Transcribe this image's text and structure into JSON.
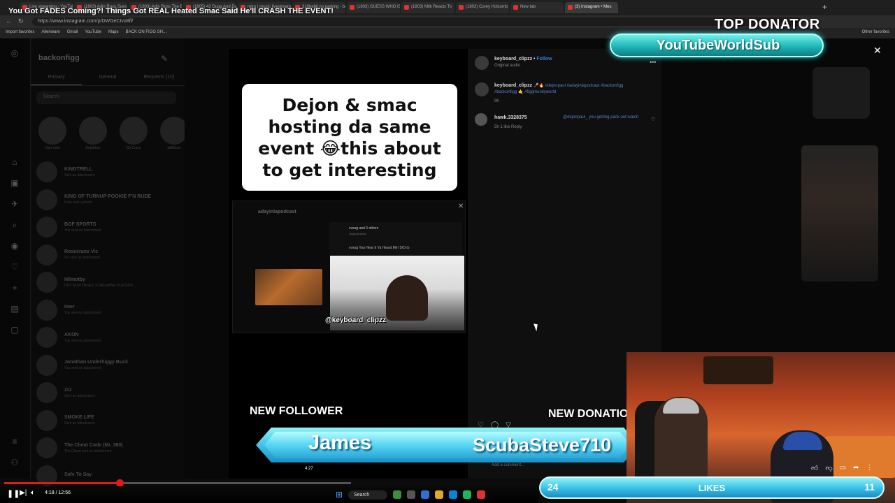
{
  "browser": {
    "video_title": "You Got FADES Coming?! Things Got REAL Heated Smac Said He'll CRASH THE EVENT!",
    "tabs": [
      "Live streaming - YouTub",
      "(1803) Adin Ross Sues E",
      "(1803) Adin Ross The Bu",
      "(1805) 42 Dugg And Da",
      "retro | music livestream",
      "310bebli no parking - ba",
      "(1803) GUESS WHO IS T",
      "(1803) Milk Reacts To",
      "(1802) Corey Holcomb D",
      "New tab",
      "(3) Instagram • Mes"
    ],
    "url": "https://www.instagram.com/p/DWGeCIvo8fl/",
    "bookmarks": [
      "Import favorites",
      "Alienware",
      "Gmail",
      "YouTube",
      "Maps",
      "BACK ON FIGG SH..."
    ],
    "other_favorites": "Other favorites"
  },
  "inbox": {
    "username": "backonfigg",
    "tabs": [
      "Primary",
      "General",
      "Requests (10)"
    ],
    "search_placeholder": "Search",
    "notes": [
      {
        "name": "Your note"
      },
      {
        "name": "Dejahbox"
      },
      {
        "name": "Cb Crazy"
      },
      {
        "name": "stiffshaw"
      }
    ],
    "threads": [
      {
        "name": "KINGTRELL",
        "preview": "Sent an attachment"
      },
      {
        "name": "KING OF TURNUP POOKIE F'N RUDE",
        "preview": "Pulls sent a photo"
      },
      {
        "name": "BOF SPORTS",
        "preview": "You sent an attachment."
      },
      {
        "name": "Rosecrans Vic",
        "preview": "Vic sent an attachment."
      },
      {
        "name": "Hilmotby",
        "preview": "OUT NOW ON ALL STREAMING PLATFOR..."
      },
      {
        "name": "Imer",
        "preview": "You sent an attachment."
      },
      {
        "name": "AKON",
        "preview": "You sent an attachment."
      },
      {
        "name": "Jonathan Underhiggy Buck",
        "preview": "You sent an attachment."
      },
      {
        "name": "ZIJ",
        "preview": "Sent an attachment."
      },
      {
        "name": "SMOKE LIFE",
        "preview": "Sent an attachment."
      },
      {
        "name": "The Cheat Code (Mr. 360)",
        "preview": "The Cheat sent an attachment."
      },
      {
        "name": "Safe To Say",
        "preview": ""
      }
    ]
  },
  "reel": {
    "meme_text": "Dejon & smac hosting da same event 😂this about to get interesting",
    "inner_title": "adayinlapodcast",
    "inner_user": "vvsog and 3 others",
    "inner_sub": "Original audio",
    "inner_caption": "vvsog You Hear It Ya Heard Me! S/O to",
    "watermark": "@keyboard_clipzz",
    "scrub_time": "4:27"
  },
  "comments": {
    "owner_user": "keyboard_clipzz",
    "follow_label": "Follow",
    "owner_sub": "Original audio",
    "caption_user": "keyboard_clipzz",
    "caption_tags": "🎤🔥 #dejonpaul #adayinlapodcast #backonfigg #backonfigg 🤙 #figgmunityworld",
    "caption_time": "9h",
    "comment_user": "hawk.3328375",
    "comment_text": "@dejonpaul_ you getting pack out watch",
    "comment_meta": "5h   1 like   Reply",
    "add_comment": "Add a comment..."
  },
  "overlays": {
    "top_donator_label": "TOP DONATOR",
    "top_donator_name": "YouTubeWorldSub",
    "new_follower_label": "NEW FOLLOWER",
    "new_follower_name": "James",
    "new_donation_label": "NEW DONATION",
    "new_donation_name": "ScubaSteve710",
    "likes_count": "24",
    "likes_label": "LIKES",
    "likes_goal": "11"
  },
  "player": {
    "time": "4:18 / 12:56",
    "progress": 0.333
  },
  "taskbar": {
    "search_label": "Search"
  },
  "colors": {
    "accent_cyan": "#37bfe6",
    "progress_red": "#e21a1a",
    "link_blue": "#3a7bd5"
  }
}
